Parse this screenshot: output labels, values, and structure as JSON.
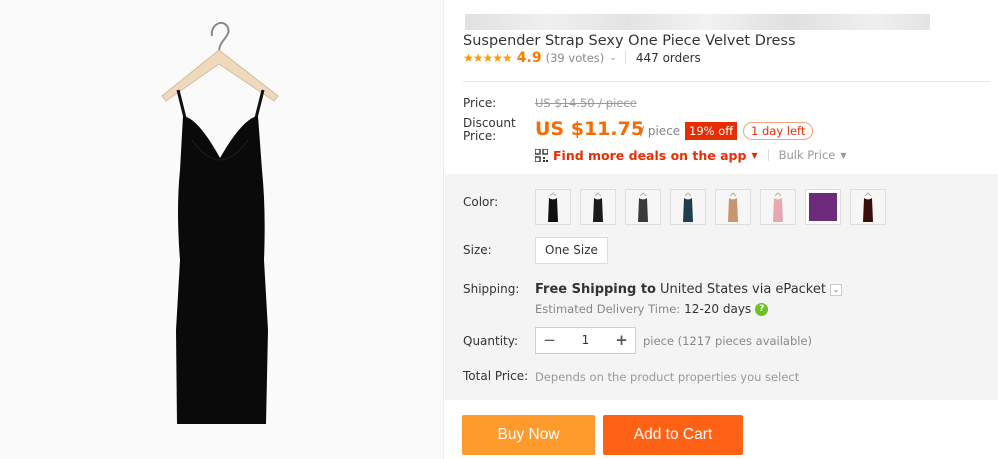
{
  "product": {
    "title": "Suspender Strap Sexy One Piece Velvet Dress",
    "stars": "★★★★★",
    "rating": "4.9",
    "votes": "(39 votes)",
    "orders": "447 orders"
  },
  "price": {
    "label": "Price:",
    "original": "US $14.50 / piece",
    "discount_label_line1": "Discount",
    "discount_label_line2": "Price:",
    "current": "US $11.75",
    "unit": "/ piece",
    "discount_badge": "19% off",
    "time_left": "1 day left",
    "deals_link": "Find more deals on the app",
    "bulk_price": "Bulk Price"
  },
  "color": {
    "label": "Color:",
    "swatches": [
      {
        "name": "black-1",
        "color": "#111111"
      },
      {
        "name": "black-2",
        "color": "#1a1a1a"
      },
      {
        "name": "dark-gray",
        "color": "#3b3b3b"
      },
      {
        "name": "teal",
        "color": "#1f3f4f"
      },
      {
        "name": "camel",
        "color": "#c9946e"
      },
      {
        "name": "pink",
        "color": "#e7a9b0"
      },
      {
        "name": "purple",
        "color": "#6e2a7a"
      },
      {
        "name": "burgundy",
        "color": "#3a0d0d"
      }
    ]
  },
  "size": {
    "label": "Size:",
    "option": "One Size"
  },
  "shipping": {
    "label": "Shipping:",
    "free_to": "Free Shipping to",
    "country": "United States",
    "method": "via ePacket",
    "delivery_label": "Estimated Delivery Time:",
    "delivery_days": "12-20 days"
  },
  "quantity": {
    "label": "Quantity:",
    "value": "1",
    "available": "piece (1217 pieces available)"
  },
  "total": {
    "label": "Total Price:",
    "note": "Depends on the product properties you select"
  },
  "actions": {
    "buy_now": "Buy Now",
    "add_to_cart": "Add to Cart"
  },
  "colors": {
    "accent_orange": "#f76a00",
    "badge_red": "#e62e04",
    "buy_now_bg": "#ff9a2c",
    "add_to_cart_bg": "#ff6215"
  }
}
